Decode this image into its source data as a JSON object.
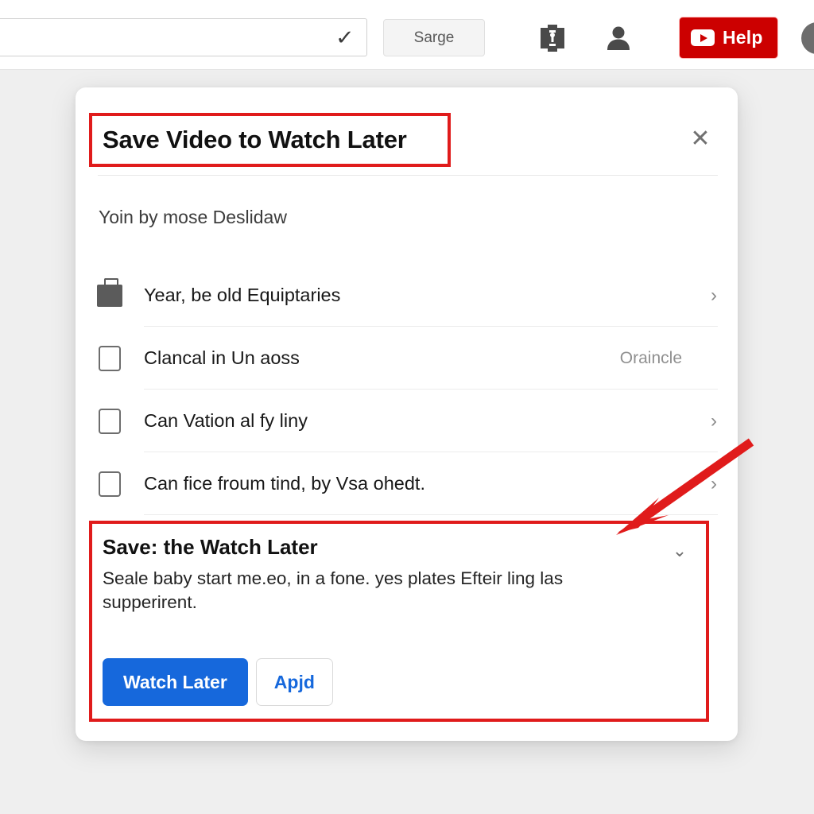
{
  "header": {
    "search": {
      "value": "",
      "placeholder": "",
      "confirm_icon": "checkmark-icon"
    },
    "sarge_label": "Sarge",
    "kit_icon": "kit-icon",
    "account_icon": "person-icon",
    "help_label": "Help",
    "help_icon": "youtube-play-icon",
    "help_color": "#cc0000",
    "edge_avatar_icon": "avatar-circle-icon"
  },
  "dialog": {
    "title": "Save Video to Watch Later",
    "close_icon": "close-x-icon",
    "subtitle": "Yoin by mose Deslidaw",
    "highlight_color": "#e01b1b",
    "options": [
      {
        "lead_icon": "briefcase-icon",
        "label": "Year, be old Equiptaries",
        "meta": "",
        "trailing_icon": "chevron-right-icon"
      },
      {
        "lead_icon": "checkbox-icon",
        "label": "Clancal in Un aoss",
        "meta": "Oraincle",
        "trailing_icon": ""
      },
      {
        "lead_icon": "checkbox-icon",
        "label": "Can Vation al fy liny",
        "meta": "",
        "trailing_icon": "chevron-right-icon"
      },
      {
        "lead_icon": "checkbox-icon",
        "label": "Can fice froum tind, by Vsa ohedt.",
        "meta": "",
        "trailing_icon": "chevron-right-icon"
      }
    ],
    "save_panel": {
      "heading": "Save: the Watch Later",
      "collapse_icon": "chevron-down-icon",
      "body": "Seale baby start me.eo, in a fone. yes plates Efteir ling las supperirent.",
      "primary_label": "Watch Later",
      "primary_color": "#1668dc",
      "secondary_label": "Apjd"
    }
  },
  "annotation": {
    "arrow_icon": "red-arrow-icon",
    "arrow_color": "#e01b1b"
  }
}
